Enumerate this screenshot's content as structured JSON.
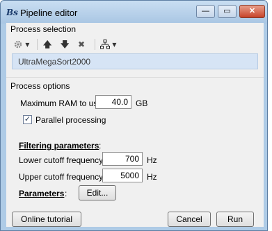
{
  "window": {
    "app_icon": "Bs",
    "title": "Pipeline editor",
    "minimize_glyph": "—",
    "maximize_glyph": "▭",
    "close_glyph": "✕"
  },
  "process_selection": {
    "label": "Process selection",
    "toolbar": {
      "gear_icon": "gear-icon",
      "dropdown_glyph": "▾",
      "up_glyph": "🡅",
      "down_glyph": "🡇",
      "delete_glyph": "✖",
      "tree_glyph": "⚯",
      "tree_dropdown_glyph": "▾"
    },
    "items": [
      "UltraMegaSort2000"
    ]
  },
  "process_options": {
    "label": "Process options",
    "max_ram_label": "Maximum RAM to use:",
    "max_ram_value": "40.0",
    "max_ram_unit": "GB",
    "parallel_label": "Parallel processing",
    "parallel_checked": true,
    "parallel_check_glyph": "✓",
    "filtering_heading": "Filtering parameters",
    "heading_colon": ":",
    "lower_label": "Lower cutoff frequency:",
    "lower_value": "700",
    "lower_unit": "Hz",
    "upper_label": "Upper cutoff frequency:",
    "upper_value": "5000",
    "upper_unit": "Hz",
    "parameters_heading": "Parameters",
    "parameters_colon": ":",
    "edit_label": "Edit..."
  },
  "footer": {
    "tutorial_label": "Online tutorial",
    "cancel_label": "Cancel",
    "run_label": "Run"
  }
}
